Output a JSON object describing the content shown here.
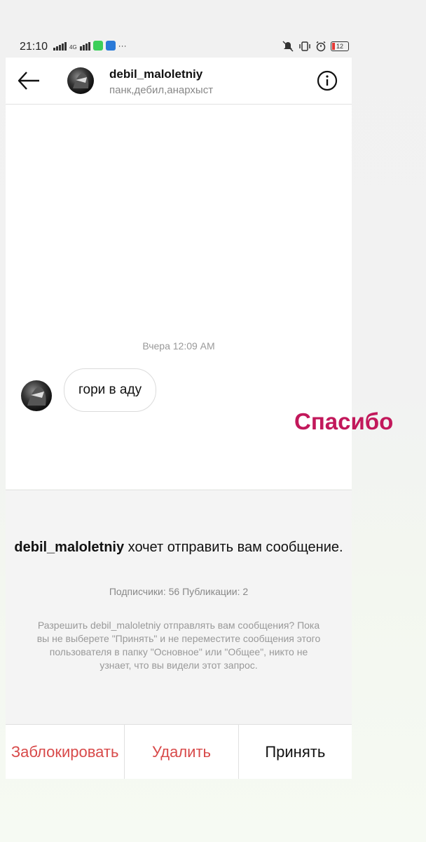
{
  "status_bar": {
    "time": "21:10",
    "network": "4G",
    "more": "···",
    "battery": "12"
  },
  "header": {
    "username": "debil_maloletniy",
    "bio": "панк,дебил,анархыст"
  },
  "chat": {
    "timestamp": "Вчера 12:09 AM",
    "messages": [
      {
        "text": "гори в аду"
      }
    ]
  },
  "overlay": {
    "text": "Спасибо",
    "color": "#c2185b"
  },
  "request": {
    "username": "debil_maloletniy",
    "title_rest": " хочет отправить вам сообщение.",
    "stats": "Подписчики: 56 Публикации: 2",
    "description": "Разрешить debil_maloletniy отправлять вам сообщения? Пока вы не выберете \"Принять\" и не переместите сообщения этого пользователя в папку \"Основное\" или \"Общее\", никто не узнает, что вы видели этот запрос."
  },
  "actions": {
    "block": "Заблокировать",
    "delete": "Удалить",
    "accept": "Принять"
  },
  "colors": {
    "danger": "#d84a4a"
  },
  "icons": [
    "back-arrow-icon",
    "info-icon",
    "signal-icon",
    "mute-icon",
    "vibrate-icon",
    "alarm-icon",
    "battery-icon"
  ]
}
